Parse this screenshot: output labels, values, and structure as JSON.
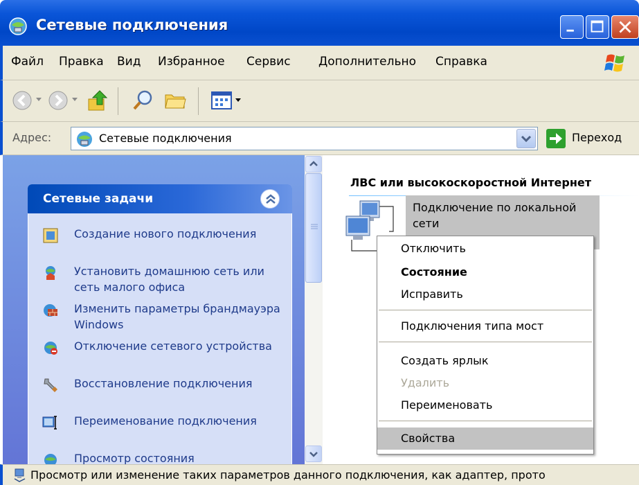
{
  "window": {
    "title": "Сетевые подключения"
  },
  "menu": [
    "Файл",
    "Правка",
    "Вид",
    "Избранное",
    "Сервис",
    "Дополнительно",
    "Справка"
  ],
  "address": {
    "label": "Адрес:",
    "value": "Сетевые подключения",
    "go_label": "Переход"
  },
  "tasks": {
    "header": "Сетевые задачи",
    "items": [
      {
        "label": "Создание нового подключения",
        "icon": "new-connection-icon"
      },
      {
        "label": "Установить домашнюю сеть или сеть малого офиса",
        "icon": "home-network-icon"
      },
      {
        "label": "Изменить параметры брандмауэра Windows",
        "icon": "firewall-icon"
      },
      {
        "label": "Отключение сетевого устройства",
        "icon": "disable-device-icon"
      },
      {
        "label": "Восстановление подключения",
        "icon": "repair-icon"
      },
      {
        "label": "Переименование подключения",
        "icon": "rename-icon"
      },
      {
        "label": "Просмотр состояния",
        "icon": "status-icon"
      }
    ]
  },
  "group": {
    "title": "ЛВС или высокоскоростной Интернет",
    "connection_label": "Подключение по локальной сети"
  },
  "context_menu": {
    "items": [
      {
        "label": "Отключить",
        "style": "normal"
      },
      {
        "label": "Состояние",
        "style": "bold"
      },
      {
        "label": "Исправить",
        "style": "normal"
      },
      {
        "label": "Подключения типа мост",
        "style": "normal"
      },
      {
        "label": "Создать ярлык",
        "style": "normal"
      },
      {
        "label": "Удалить",
        "style": "disabled"
      },
      {
        "label": "Переименовать",
        "style": "normal"
      },
      {
        "label": "Свойства",
        "style": "highlight"
      }
    ]
  },
  "status": {
    "text": "Просмотр или изменение таких параметров данного подключения, как адаптер, прото"
  }
}
